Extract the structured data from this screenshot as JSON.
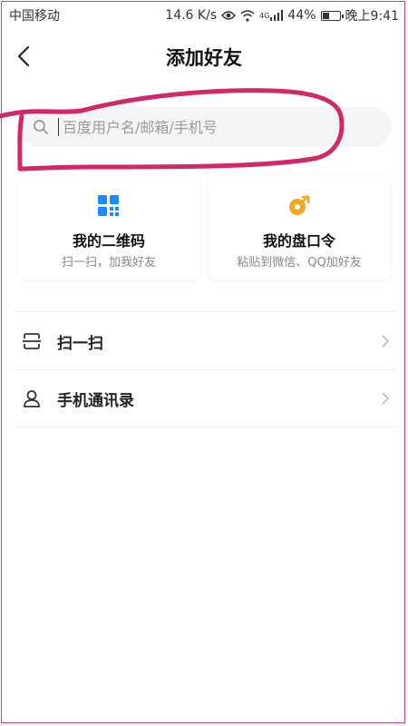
{
  "status_bar": {
    "carrier": "中国移动",
    "network_speed": "14.6 K/s",
    "network_type": "4G",
    "battery": "44%",
    "battery_level": 0.44,
    "time": "晚上9:41",
    "icons": [
      "eye-icon",
      "wifi-icon",
      "signal-icon",
      "battery-icon"
    ]
  },
  "header": {
    "title": "添加好友",
    "back_icon": "chevron-left-icon"
  },
  "search": {
    "placeholder": "百度用户名/邮箱/手机号",
    "value": ""
  },
  "annotation": {
    "color": "#d2286a"
  },
  "cards": [
    {
      "title": "我的二维码",
      "subtitle": "扫一扫，加我好友",
      "icon": "qr-code-icon",
      "color": "#1a8cff"
    },
    {
      "title": "我的盘口令",
      "subtitle": "粘贴到微信、QQ加好友",
      "icon": "passcode-icon",
      "color": "#f5a623"
    }
  ],
  "menu": {
    "items": [
      {
        "label": "扫一扫",
        "icon": "scan-icon"
      },
      {
        "label": "手机通讯录",
        "icon": "contacts-icon"
      }
    ]
  },
  "colors": {
    "search_bg": "#f3f4f6",
    "frame": "#e23c6e"
  }
}
